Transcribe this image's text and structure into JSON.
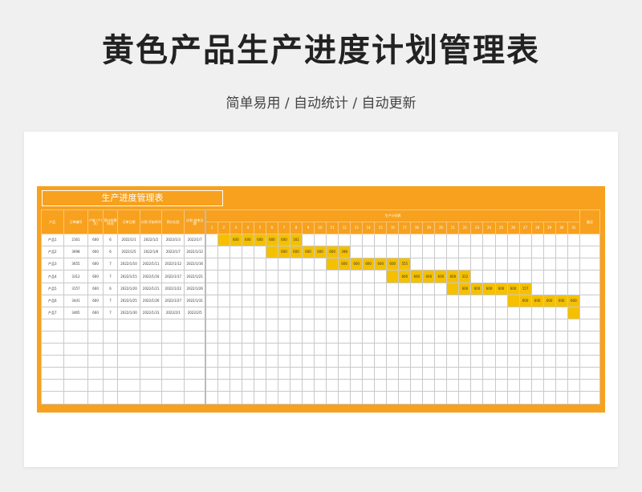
{
  "title": "黄色产品生产进度计划管理表",
  "subtitle": "简单易用 / 自动统计 / 自动更新",
  "sheet_title": "生产进度管理表",
  "headers": {
    "product": "产品",
    "order_no": "订单编号",
    "output": "产能 (个/天)",
    "days": "预计所需时间",
    "order_date": "订单日期",
    "plan_start": "计划 开始时间",
    "ship_date": "预计出货",
    "plan_end": "计划 结束日期",
    "plan_area": "生产计划表",
    "note": "备注"
  },
  "day_numbers": [
    1,
    2,
    3,
    4,
    5,
    6,
    7,
    8,
    9,
    10,
    11,
    12,
    13,
    14,
    15,
    16,
    17,
    18,
    19,
    20,
    21,
    22,
    23,
    24,
    25,
    26,
    27,
    28,
    29,
    30,
    31
  ],
  "rows": [
    {
      "product": "产品1",
      "order_no": "2161",
      "output": "600",
      "days": "6",
      "order_date": "2022/1/1",
      "plan_start": "2022/1/2",
      "ship_date": "2022/1/3",
      "plan_end": "2022/1/7",
      "start": 2,
      "cells": [
        "",
        "600",
        "600",
        "600",
        "600",
        "600",
        "161"
      ]
    },
    {
      "product": "产品2",
      "order_no": "3698",
      "output": "600",
      "days": "6",
      "order_date": "2022/1/5",
      "plan_start": "2022/1/6",
      "ship_date": "2022/1/7",
      "plan_end": "2022/1/12",
      "start": 6,
      "cells": [
        "",
        "600",
        "600",
        "600",
        "600",
        "600",
        "398"
      ]
    },
    {
      "product": "产品3",
      "order_no": "3655",
      "output": "600",
      "days": "7",
      "order_date": "2022/1/10",
      "plan_start": "2022/1/11",
      "ship_date": "2022/1/12",
      "plan_end": "2022/1/16",
      "start": 11,
      "cells": [
        "",
        "600",
        "600",
        "600",
        "600",
        "600",
        "555"
      ]
    },
    {
      "product": "产品4",
      "order_no": "3312",
      "output": "600",
      "days": "7",
      "order_date": "2022/1/15",
      "plan_start": "2022/1/16",
      "ship_date": "2022/1/17",
      "plan_end": "2022/1/21",
      "start": 16,
      "cells": [
        "",
        "600",
        "600",
        "600",
        "600",
        "600",
        "312"
      ]
    },
    {
      "product": "产品5",
      "order_no": "3157",
      "output": "600",
      "days": "6",
      "order_date": "2022/1/20",
      "plan_start": "2022/1/21",
      "ship_date": "2022/1/22",
      "plan_end": "2022/1/26",
      "start": 21,
      "cells": [
        "",
        "600",
        "600",
        "600",
        "600",
        "600",
        "157"
      ]
    },
    {
      "product": "产品6",
      "order_no": "3441",
      "output": "600",
      "days": "7",
      "order_date": "2022/1/25",
      "plan_start": "2022/1/26",
      "ship_date": "2022/1/27",
      "plan_end": "2022/1/31",
      "start": 26,
      "cells": [
        "",
        "600",
        "600",
        "600",
        "600",
        "600"
      ]
    },
    {
      "product": "产品7",
      "order_no": "3465",
      "output": "600",
      "days": "7",
      "order_date": "2022/1/30",
      "plan_start": "2022/1/31",
      "ship_date": "2022/2/1",
      "plan_end": "2022/2/5",
      "start": 31,
      "cells": [
        ""
      ]
    }
  ],
  "empty_rows": 7
}
